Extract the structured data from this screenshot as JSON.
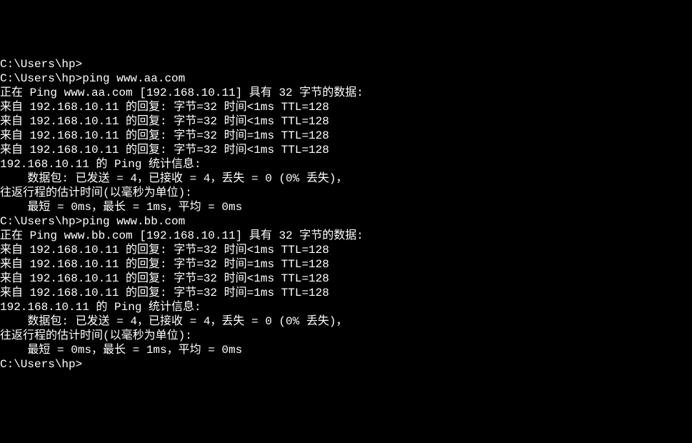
{
  "terminal": {
    "lines": [
      "C:\\Users\\hp>",
      "C:\\Users\\hp>ping www.aa.com",
      "",
      "正在 Ping www.aa.com [192.168.10.11] 具有 32 字节的数据:",
      "来自 192.168.10.11 的回复: 字节=32 时间<1ms TTL=128",
      "来自 192.168.10.11 的回复: 字节=32 时间<1ms TTL=128",
      "来自 192.168.10.11 的回复: 字节=32 时间=1ms TTL=128",
      "来自 192.168.10.11 的回复: 字节=32 时间<1ms TTL=128",
      "",
      "192.168.10.11 的 Ping 统计信息:",
      "    数据包: 已发送 = 4，已接收 = 4，丢失 = 0 (0% 丢失)，",
      "往返行程的估计时间(以毫秒为单位):",
      "    最短 = 0ms，最长 = 1ms，平均 = 0ms",
      "",
      "C:\\Users\\hp>ping www.bb.com",
      "",
      "正在 Ping www.bb.com [192.168.10.11] 具有 32 字节的数据:",
      "来自 192.168.10.11 的回复: 字节=32 时间<1ms TTL=128",
      "来自 192.168.10.11 的回复: 字节=32 时间=1ms TTL=128",
      "来自 192.168.10.11 的回复: 字节=32 时间<1ms TTL=128",
      "来自 192.168.10.11 的回复: 字节=32 时间=1ms TTL=128",
      "",
      "192.168.10.11 的 Ping 统计信息:",
      "    数据包: 已发送 = 4，已接收 = 4，丢失 = 0 (0% 丢失)，",
      "往返行程的估计时间(以毫秒为单位):",
      "    最短 = 0ms，最长 = 1ms，平均 = 0ms",
      "",
      "C:\\Users\\hp>"
    ]
  }
}
